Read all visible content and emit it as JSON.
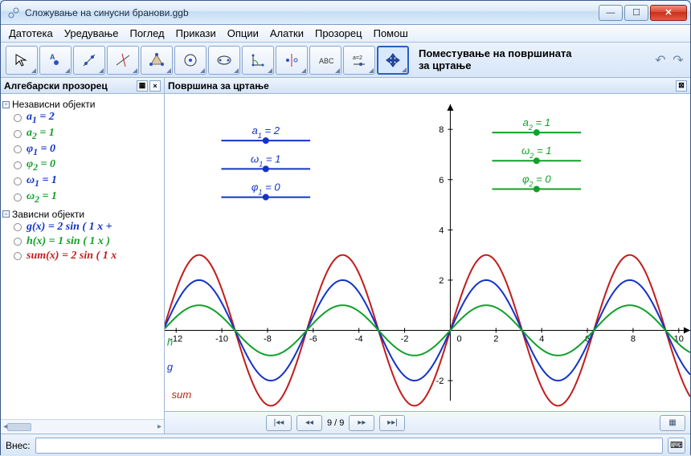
{
  "window": {
    "title": "Сложување на синусни бранови.ggb"
  },
  "menu": [
    "Датотека",
    "Уредување",
    "Поглед",
    "Прикази",
    "Опции",
    "Алатки",
    "Прозорец",
    "Помош"
  ],
  "toolbar": {
    "active_tool_line1": "Поместување на површината",
    "active_tool_line2": "за цртање"
  },
  "panels": {
    "algebra_title": "Алгебарски прозорец",
    "drawing_title": "Површина за цртање"
  },
  "algebra": {
    "group1": "Независни објекти",
    "group2": "Зависни објекти",
    "items_indep": [
      {
        "label": "a",
        "sub": "1",
        "eq": " = 2",
        "color": "#1334c8"
      },
      {
        "label": "a",
        "sub": "2",
        "eq": " = 1",
        "color": "#11a02a"
      },
      {
        "label": "φ",
        "sub": "1",
        "eq": " = 0",
        "color": "#1334c8"
      },
      {
        "label": "φ",
        "sub": "2",
        "eq": " = 0",
        "color": "#11a02a"
      },
      {
        "label": "ω",
        "sub": "1",
        "eq": " = 1",
        "color": "#1334c8"
      },
      {
        "label": "ω",
        "sub": "2",
        "eq": " = 1",
        "color": "#11a02a"
      }
    ],
    "items_dep": [
      {
        "text": "g(x)  =  2  sin ( 1 x  +",
        "color": "#1334c8"
      },
      {
        "text": "h(x)  =  1  sin ( 1 x )",
        "color": "#11a02a"
      },
      {
        "text": "sum(x)  =  2  sin ( 1 x",
        "color": "#c21d1d"
      }
    ]
  },
  "sliders": {
    "set1": [
      {
        "name": "a",
        "sub": "1",
        "val": " = 2",
        "color": "#1334c8",
        "knob": 0.5,
        "y": 45
      },
      {
        "name": "ω",
        "sub": "1",
        "val": " = 1",
        "color": "#1334c8",
        "knob": 0.5,
        "y": 80
      },
      {
        "name": "φ",
        "sub": "1",
        "val": " = 0",
        "color": "#1334c8",
        "knob": 0.5,
        "y": 115
      }
    ],
    "set2": [
      {
        "name": "a",
        "sub": "2",
        "val": " = 1",
        "color": "#11a02a",
        "knob": 0.5,
        "y": 35
      },
      {
        "name": "ω",
        "sub": "2",
        "val": " = 1",
        "color": "#11a02a",
        "knob": 0.5,
        "y": 70
      },
      {
        "name": "φ",
        "sub": "2",
        "val": " = 0",
        "color": "#11a02a",
        "knob": 0.5,
        "y": 105
      }
    ]
  },
  "chart_data": {
    "type": "line",
    "xlim": [
      -12.5,
      10.5
    ],
    "ylim": [
      -2.8,
      9
    ],
    "xticks": [
      -12,
      -10,
      -8,
      -6,
      -4,
      -2,
      0,
      2,
      4,
      6,
      8,
      10
    ],
    "yticks": [
      -2,
      0,
      2,
      4,
      6,
      8
    ],
    "series": [
      {
        "name": "sum",
        "color": "#c21d1d",
        "amp": 3,
        "omega": 1,
        "phi": 0
      },
      {
        "name": "g",
        "color": "#1334c8",
        "amp": 2,
        "omega": 1,
        "phi": 0
      },
      {
        "name": "h",
        "color": "#11a02a",
        "amp": 1,
        "omega": 1,
        "phi": 0
      }
    ],
    "func_labels": [
      {
        "text": "h",
        "color": "#11a02a",
        "x": -12.4,
        "y": -0.6
      },
      {
        "text": "g",
        "color": "#1334c8",
        "x": -12.4,
        "y": -1.6
      },
      {
        "text": "sum",
        "color": "#c21d1d",
        "x": -12.2,
        "y": -2.7
      }
    ]
  },
  "playbar": {
    "step": "9 / 9"
  },
  "input": {
    "label": "Внес:",
    "placeholder": ""
  }
}
